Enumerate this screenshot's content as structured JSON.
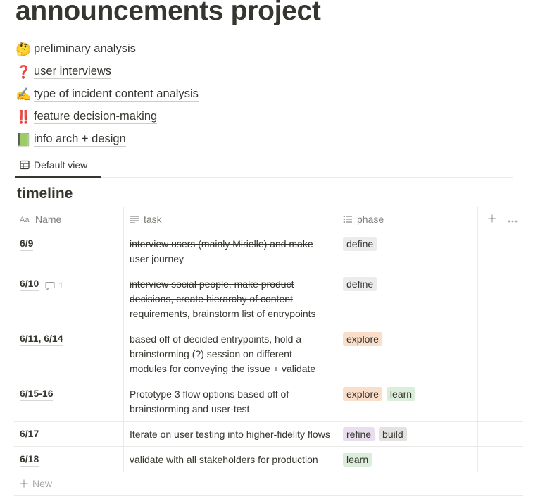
{
  "page": {
    "title": "announcements project"
  },
  "links": [
    {
      "emoji": "🤔",
      "icon": "thinking-face-icon",
      "label": "preliminary analysis"
    },
    {
      "emoji": "❓",
      "icon": "question-mark-icon",
      "label": "user interviews"
    },
    {
      "emoji": "✍️",
      "icon": "writing-hand-icon",
      "label": "type of incident content analysis"
    },
    {
      "emoji": "‼️",
      "icon": "double-exclamation-icon",
      "label": "feature decision-making"
    },
    {
      "emoji": "📗",
      "icon": "green-book-icon",
      "label": "info arch + design"
    }
  ],
  "views": {
    "active_label": "Default view"
  },
  "database": {
    "title": "timeline",
    "columns": {
      "name": "Name",
      "task": "task",
      "phase": "phase"
    },
    "new_label": "New",
    "rows": [
      {
        "name": "6/9",
        "task": "interview users (mainly Mirielle) and make user journey",
        "struck": true,
        "comments": null,
        "phases": [
          "define"
        ]
      },
      {
        "name": "6/10",
        "task": "interview social people, make product decisions, create hierarchy of content requirements, brainstorm list of entrypoints",
        "struck": true,
        "comments": "1",
        "phases": [
          "define"
        ]
      },
      {
        "name": "6/11, 6/14",
        "task": "based off of decided entrypoints, hold a brainstorming (?) session on different modules for conveying the issue + validate",
        "struck": false,
        "comments": null,
        "phases": [
          "explore"
        ]
      },
      {
        "name": "6/15-16",
        "task": "Prototype 3 flow options based off of brainstorming and user-test",
        "struck": false,
        "comments": null,
        "phases": [
          "explore",
          "learn"
        ]
      },
      {
        "name": "6/17",
        "task": "Iterate on user testing into higher-fidelity flows",
        "struck": false,
        "comments": null,
        "phases": [
          "refine",
          "build"
        ]
      },
      {
        "name": "6/18",
        "task": "validate with all stakeholders for production",
        "struck": false,
        "comments": null,
        "phases": [
          "learn"
        ]
      }
    ]
  },
  "tag_colors": {
    "define": "#ebeced",
    "explore": "#fadec9",
    "learn": "#dbeddb",
    "refine": "#e8deee",
    "build": "#e3e2e0"
  }
}
